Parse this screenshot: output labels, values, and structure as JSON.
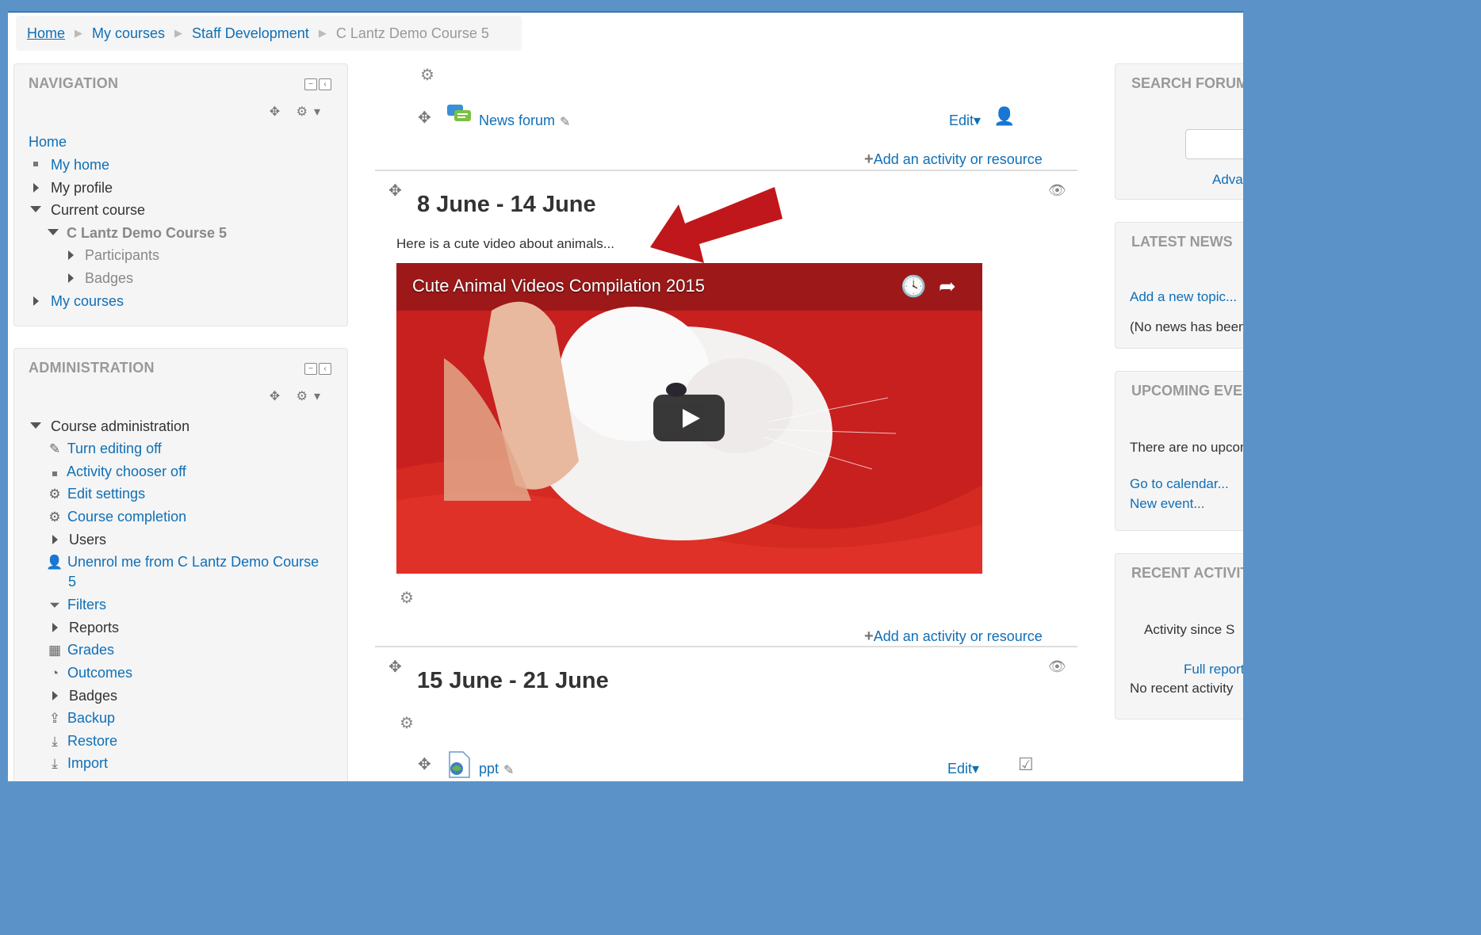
{
  "breadcrumb": {
    "items": [
      "Home",
      "My courses",
      "Staff Development",
      "C Lantz Demo Course 5"
    ]
  },
  "navigation": {
    "title": "NAVIGATION",
    "items": [
      {
        "label": "Home"
      },
      {
        "label": "My home"
      },
      {
        "label": "My profile"
      },
      {
        "label": "Current course"
      },
      {
        "label": "C Lantz Demo Course 5"
      },
      {
        "label": "Participants"
      },
      {
        "label": "Badges"
      },
      {
        "label": "My courses"
      }
    ]
  },
  "administration": {
    "title": "ADMINISTRATION",
    "items": [
      {
        "label": "Course administration",
        "icon": "triangle-down"
      },
      {
        "label": "Turn editing off",
        "icon": "pencil-icon"
      },
      {
        "label": "Activity chooser off",
        "icon": "bullet"
      },
      {
        "label": "Edit settings",
        "icon": "gear-icon"
      },
      {
        "label": "Course completion",
        "icon": "gear-icon"
      },
      {
        "label": "Users",
        "icon": "triangle-right"
      },
      {
        "label": "Unenrol me from C Lantz Demo Course",
        "icon": "user-icon"
      },
      {
        "label": "5",
        "icon": ""
      },
      {
        "label": "Filters",
        "icon": "filter-icon"
      },
      {
        "label": "Reports",
        "icon": "triangle-right"
      },
      {
        "label": "Grades",
        "icon": "table-icon"
      },
      {
        "label": "Outcomes",
        "icon": "pie-icon"
      },
      {
        "label": "Badges",
        "icon": "triangle-right"
      },
      {
        "label": "Backup",
        "icon": "upload-icon"
      },
      {
        "label": "Restore",
        "icon": "download-icon"
      },
      {
        "label": "Import",
        "icon": "download-icon"
      }
    ]
  },
  "main": {
    "news_forum": "News forum",
    "edit_label": "Edit",
    "add_activity": "Add an activity or resource",
    "section1": {
      "title": "8 June - 14 June",
      "summary": "Here is a cute video about animals...",
      "video_title": "Cute Animal Videos Compilation 2015"
    },
    "section2": {
      "title": "15 June - 21 June",
      "resource": "ppt"
    }
  },
  "right": {
    "search": {
      "title": "SEARCH FORUMS",
      "advanced": "Advanced search"
    },
    "latest_news": {
      "title": "LATEST NEWS",
      "add_topic": "Add a new topic...",
      "empty": "(No news has been posted yet)"
    },
    "upcoming": {
      "title": "UPCOMING EVENTS",
      "empty": "There are no upcoming events",
      "calendar": "Go to calendar...",
      "new_event": "New event..."
    },
    "recent": {
      "title": "RECENT ACTIVITY",
      "since": "Activity since S",
      "full_report": "Full report",
      "empty": "No recent activity"
    }
  },
  "colors": {
    "link": "#0f6fb6",
    "annotation_arrow": "#c0171c",
    "frame": "#5b93c9"
  }
}
